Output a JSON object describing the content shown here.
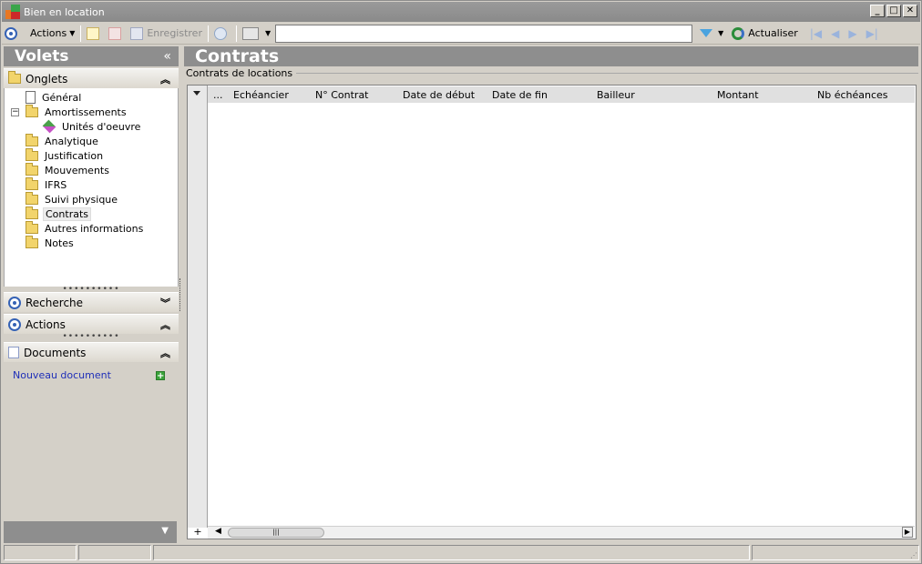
{
  "window": {
    "title": "Bien en location"
  },
  "toolbar": {
    "actions_label": "Actions",
    "save_label": "Enregistrer",
    "search_value": "",
    "refresh_label": "Actualiser"
  },
  "left_pane": {
    "title": "Volets",
    "collapse_glyph": "«",
    "tabs_section": "Onglets",
    "tree": [
      {
        "label": "Général",
        "icon": "document-icon"
      },
      {
        "label": "Amortissements",
        "icon": "folder-icon"
      },
      {
        "label": "Unités d'oeuvre",
        "icon": "units-icon"
      },
      {
        "label": "Analytique",
        "icon": "folder-icon"
      },
      {
        "label": "Justification",
        "icon": "folder-icon"
      },
      {
        "label": "Mouvements",
        "icon": "folder-icon"
      },
      {
        "label": "IFRS",
        "icon": "folder-icon"
      },
      {
        "label": "Suivi physique",
        "icon": "folder-icon"
      },
      {
        "label": "Contrats",
        "icon": "folder-open-icon"
      },
      {
        "label": "Autres informations",
        "icon": "folder-icon"
      },
      {
        "label": "Notes",
        "icon": "folder-icon"
      }
    ],
    "search_section": "Recherche",
    "actions_section": "Actions",
    "documents_section": "Documents",
    "new_document": "Nouveau document"
  },
  "main": {
    "title": "Contrats",
    "section_label": "Contrats de locations",
    "columns": [
      "...",
      "Echéancier",
      "N° Contrat",
      "Date de début",
      "Date de fin",
      "Bailleur",
      "Montant",
      "Nb échéances"
    ],
    "add_row_glyph": "+"
  },
  "colors": {
    "pane_header": "#8e8e8e",
    "link": "#1f2fb8",
    "window_bg": "#d4d0c8"
  }
}
